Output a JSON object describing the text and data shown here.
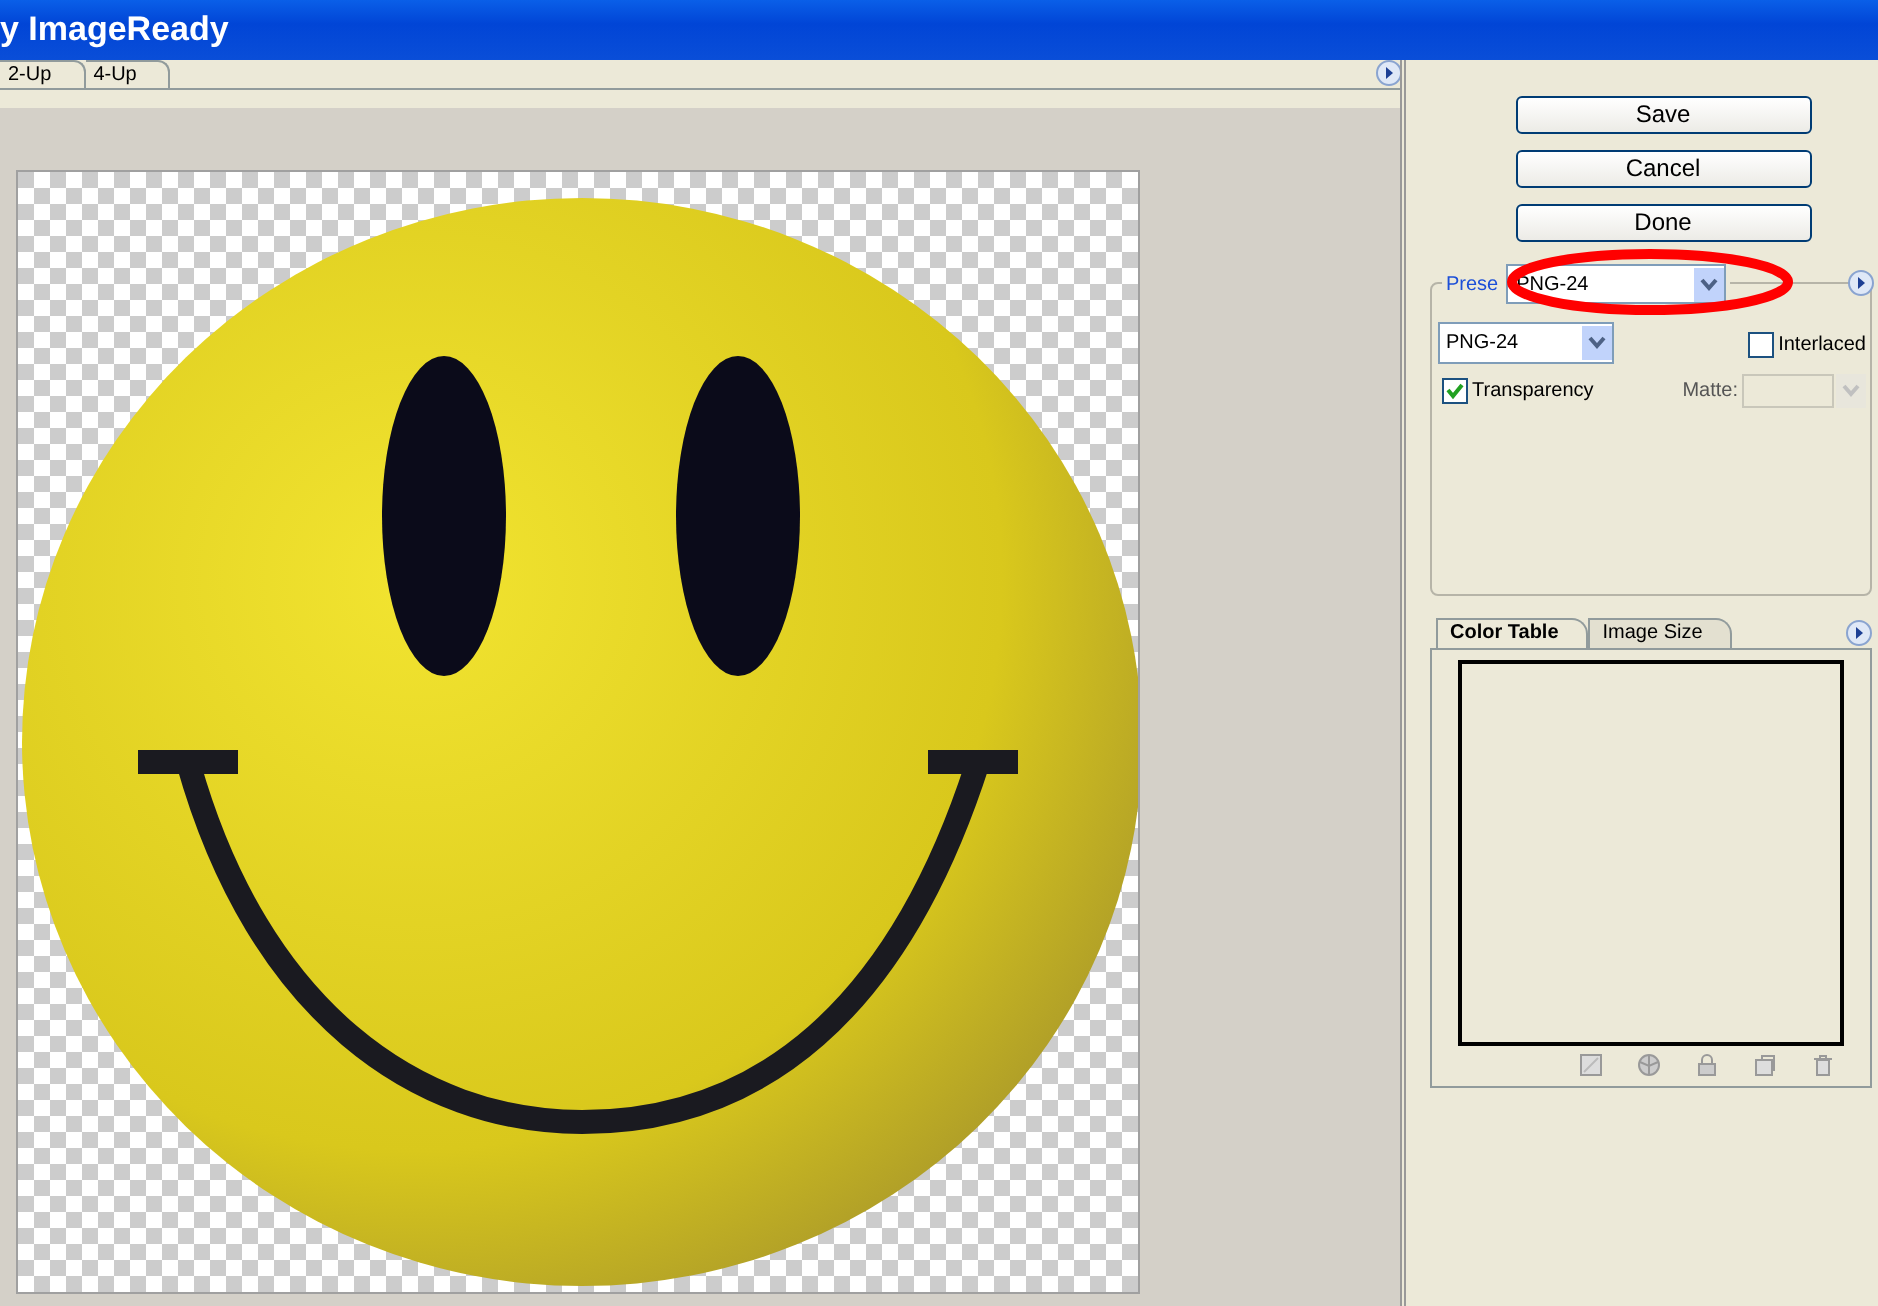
{
  "window": {
    "title": "y ImageReady"
  },
  "view_tabs": [
    {
      "label": "2-Up",
      "selected": false
    },
    {
      "label": "4-Up",
      "selected": false
    }
  ],
  "buttons": [
    "Save",
    "Cancel",
    "Done"
  ],
  "preset": {
    "label": "Prese",
    "value": "PNG-24",
    "format": "PNG-24",
    "interlaced": {
      "label": "Interlaced",
      "checked": false
    },
    "transparency": {
      "label": "Transparency",
      "checked": true
    },
    "matte": {
      "label": "Matte:",
      "disabled": true
    }
  },
  "panel_tabs": [
    {
      "label": "Color Table",
      "selected": true
    },
    {
      "label": "Image Size",
      "selected": false
    }
  ]
}
